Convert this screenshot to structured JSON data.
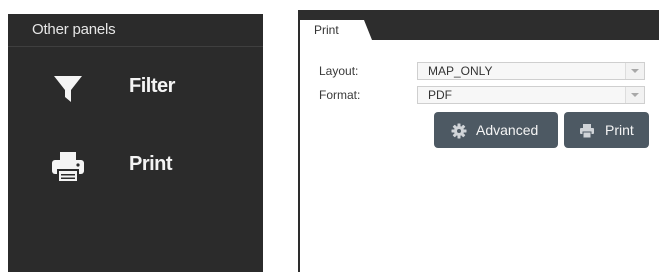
{
  "other_panels": {
    "title": "Other panels",
    "items": [
      {
        "label": "Filter",
        "icon": "filter-icon"
      },
      {
        "label": "Print",
        "icon": "printer-icon"
      }
    ]
  },
  "print_dialog": {
    "tab": {
      "label": "Print"
    },
    "layout": {
      "label": "Layout:",
      "value": "MAP_ONLY"
    },
    "format": {
      "label": "Format:",
      "value": "PDF"
    },
    "buttons": {
      "advanced": {
        "label": "Advanced",
        "icon": "gear-icon"
      },
      "print": {
        "label": "Print",
        "icon": "printer-icon"
      }
    }
  },
  "colors": {
    "panel_bg": "#2b2b2b",
    "button_bg": "#4d5963",
    "tab_bar": "#2d2d2d"
  }
}
